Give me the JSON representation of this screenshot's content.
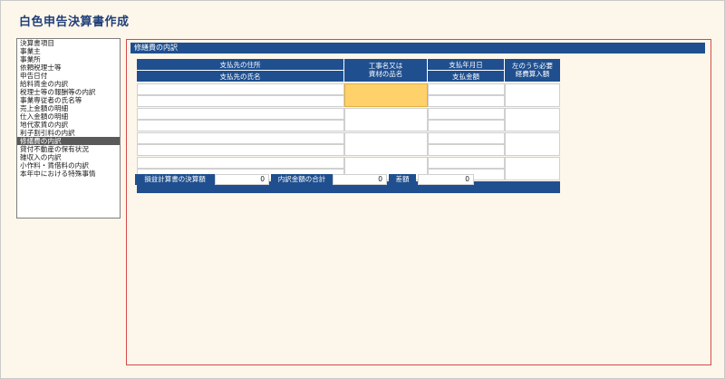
{
  "app": {
    "title": "白色申告決算書作成"
  },
  "sidebar": {
    "items": [
      {
        "label": "決算書項目"
      },
      {
        "label": "事業主"
      },
      {
        "label": "事業所"
      },
      {
        "label": "依頼税理士等"
      },
      {
        "label": "申告日付"
      },
      {
        "label": "給料賃金の内訳"
      },
      {
        "label": "税理士等の報酬等の内訳"
      },
      {
        "label": "事業専従者の氏名等"
      },
      {
        "label": "売上金額の明細"
      },
      {
        "label": "仕入金額の明細"
      },
      {
        "label": "地代家賃の内訳"
      },
      {
        "label": "利子割引料の内訳"
      },
      {
        "label": "修繕費の内訳"
      },
      {
        "label": "貸付不動産の保有状況"
      },
      {
        "label": "雑収入の内訳"
      },
      {
        "label": "小作料・賃借料の内訳"
      },
      {
        "label": "本年中における特殊事情"
      }
    ],
    "selected_index": 12
  },
  "panel": {
    "header": "修繕費の内訳",
    "table": {
      "col_address": "支払先の住所",
      "col_name": "支払先の氏名",
      "col_work_1": "工事名又は",
      "col_work_2": "資材の品名",
      "col_date": "支払年月日",
      "col_amount": "支払金額",
      "col_expense_1": "左のうち必要",
      "col_expense_2": "経費算入額"
    },
    "summary": {
      "book_label": "損益計算書の決算額",
      "book_value": "0",
      "total_label": "内訳金額の合計",
      "total_value": "0",
      "diff_label": "差額",
      "diff_value": "0"
    }
  },
  "colors": {
    "header_blue": "#1f4f8f",
    "highlight": "#fed16b",
    "panel_border": "#d44a4a"
  }
}
